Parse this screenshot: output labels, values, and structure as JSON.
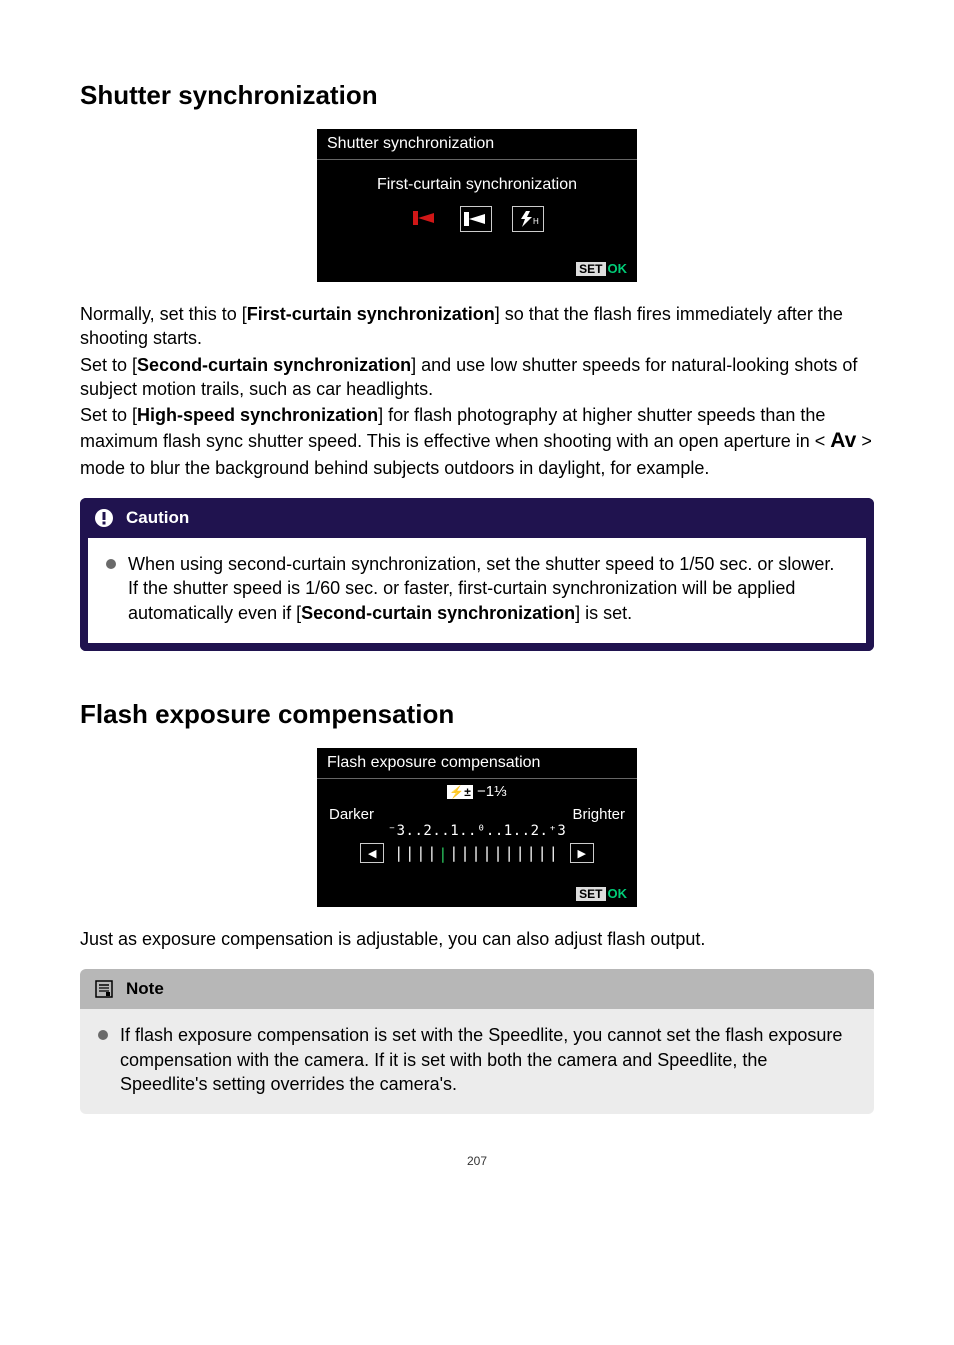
{
  "section1": {
    "heading": "Shutter synchronization",
    "screenshot": {
      "title": "Shutter synchronization",
      "subtitle": "First-curtain synchronization",
      "set": "SET",
      "ok": "OK"
    },
    "para1_a": "Normally, set this to [",
    "para1_b": "First-curtain synchronization",
    "para1_c": "] so that the flash fires immediately after the shooting starts.",
    "para2_a": "Set to [",
    "para2_b": "Second-curtain synchronization",
    "para2_c": "] and use low shutter speeds for natural-looking shots of subject motion trails, such as car headlights.",
    "para3_a": "Set to [",
    "para3_b": "High-speed synchronization",
    "para3_c": "] for flash photography at higher shutter speeds than the maximum flash sync shutter speed. This is effective when shooting with an open aperture in < ",
    "para3_av": "Av",
    "para3_d": " > mode to blur the background behind subjects outdoors in daylight, for example.",
    "caution": {
      "label": "Caution",
      "text_a": "When using second-curtain synchronization, set the shutter speed to 1/50 sec. or slower. If the shutter speed is 1/60 sec. or faster, first-curtain synchronization will be applied automatically even if [",
      "text_b": "Second-curtain synchronization",
      "text_c": "] is set."
    }
  },
  "section2": {
    "heading": "Flash exposure compensation",
    "screenshot": {
      "title": "Flash exposure compensation",
      "value": "⚡ −1⅓",
      "darker": "Darker",
      "brighter": "Brighter",
      "scale": "⁻3..2..1..⁰..1..2.⁺3",
      "set": "SET",
      "ok": "OK"
    },
    "para": "Just as exposure compensation is adjustable, you can also adjust flash output.",
    "note": {
      "label": "Note",
      "text": "If flash exposure compensation is set with the Speedlite, you cannot set the flash exposure compensation with the camera. If it is set with both the camera and Speedlite, the Speedlite's setting overrides the camera's."
    }
  },
  "page_number": "207"
}
